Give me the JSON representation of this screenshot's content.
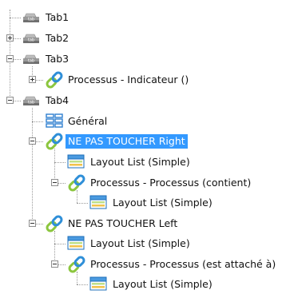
{
  "tree": {
    "nodes": [
      {
        "key": "tab1",
        "label": "Tab1",
        "level": 0,
        "icon": "tab-icon",
        "toggle": "none",
        "selected": false
      },
      {
        "key": "tab2",
        "label": "Tab2",
        "level": 0,
        "icon": "tab-icon",
        "toggle": "collapsed",
        "selected": false
      },
      {
        "key": "tab3",
        "label": "Tab3",
        "level": 0,
        "icon": "tab-icon",
        "toggle": "expanded",
        "selected": false
      },
      {
        "key": "tab3-processus-indicateur",
        "label": "Processus - Indicateur ()",
        "level": 1,
        "icon": "link-icon",
        "toggle": "collapsed",
        "selected": false
      },
      {
        "key": "tab4",
        "label": "Tab4",
        "level": 0,
        "icon": "tab-icon",
        "toggle": "expanded",
        "selected": false
      },
      {
        "key": "tab4-general",
        "label": "Général",
        "level": 1,
        "icon": "layout-icon",
        "toggle": "none",
        "selected": false
      },
      {
        "key": "ne-pas-toucher-right",
        "label": "NE PAS TOUCHER Right",
        "level": 1,
        "icon": "link-icon",
        "toggle": "expanded",
        "selected": true
      },
      {
        "key": "right-layout-list",
        "label": "Layout List (Simple)",
        "level": 2,
        "icon": "layout-list-icon",
        "toggle": "none",
        "selected": false
      },
      {
        "key": "right-processus-contient",
        "label": "Processus - Processus (contient)",
        "level": 2,
        "icon": "link-icon",
        "toggle": "expanded",
        "selected": false
      },
      {
        "key": "right-contient-layout-list",
        "label": "Layout List (Simple)",
        "level": 3,
        "icon": "layout-list-icon",
        "toggle": "none",
        "selected": false
      },
      {
        "key": "ne-pas-toucher-left",
        "label": "NE PAS TOUCHER Left",
        "level": 1,
        "icon": "link-icon",
        "toggle": "expanded",
        "selected": false
      },
      {
        "key": "left-layout-list",
        "label": "Layout List (Simple)",
        "level": 2,
        "icon": "layout-list-icon",
        "toggle": "none",
        "selected": false
      },
      {
        "key": "left-processus-attache",
        "label": "Processus - Processus (est attaché à)",
        "level": 2,
        "icon": "link-icon",
        "toggle": "expanded",
        "selected": false
      },
      {
        "key": "left-attache-layout-list",
        "label": "Layout List (Simple)",
        "level": 3,
        "icon": "layout-list-icon",
        "toggle": "none",
        "selected": false
      }
    ]
  },
  "colors": {
    "selection": "#3399ff",
    "link_green": "#8cc63f",
    "link_blue": "#2f8fd8",
    "layout_blue": "#2f7fd0",
    "tab_gray": "#9a9a9a"
  }
}
